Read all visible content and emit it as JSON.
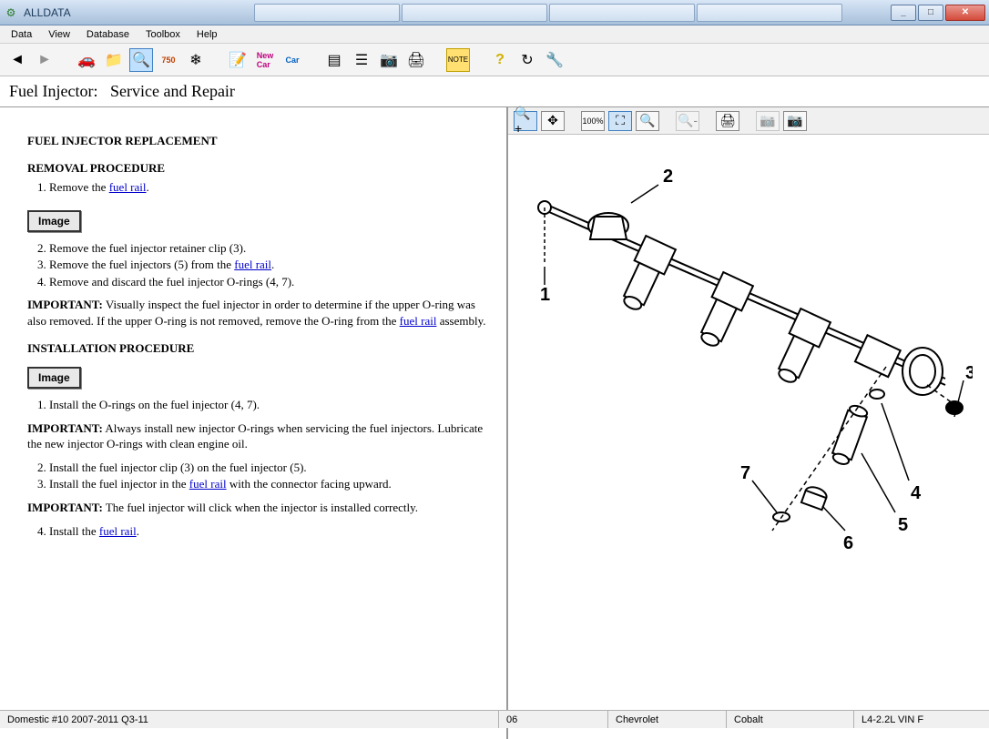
{
  "window": {
    "title": "ALLDATA"
  },
  "menu": {
    "items": [
      "Data",
      "View",
      "Database",
      "Toolbox",
      "Help"
    ]
  },
  "page": {
    "title_prefix": "Fuel Injector:",
    "title_suffix": "Service and Repair"
  },
  "content": {
    "h1": "FUEL INJECTOR REPLACEMENT",
    "h2_removal": "REMOVAL PROCEDURE",
    "removal_1_a": "Remove the ",
    "removal_1_link": "fuel rail",
    "removal_1_b": ".",
    "image_btn": "Image",
    "removal_2": "Remove the fuel injector retainer clip (3).",
    "removal_3_a": "Remove the fuel injectors (5) from the ",
    "removal_3_link": "fuel rail",
    "removal_3_b": ".",
    "removal_4": "Remove and discard the fuel injector O-rings (4, 7).",
    "important_label": "IMPORTANT:",
    "important1_a": "Visually inspect the fuel injector in order to determine if the upper O-ring was also removed. If the upper O-ring is not removed, remove the O-ring from the ",
    "important1_link": "fuel rail",
    "important1_b": " assembly.",
    "h2_install": "INSTALLATION PROCEDURE",
    "install_1": "Install the O-rings on the fuel injector (4, 7).",
    "important2": "Always install new injector O-rings when servicing the fuel injectors. Lubricate the new injector O-rings with clean engine oil.",
    "install_2": "Install the fuel injector clip (3) on the fuel injector (5).",
    "install_3_a": "Install the fuel injector in the ",
    "install_3_link": "fuel rail",
    "install_3_b": " with the connector facing upward.",
    "important3": "The fuel injector will click when the injector is installed correctly.",
    "install_4_a": "Install the ",
    "install_4_link": "fuel rail",
    "install_4_b": "."
  },
  "diagram_labels": [
    "1",
    "2",
    "3",
    "4",
    "5",
    "6",
    "7"
  ],
  "status": {
    "db": "Domestic #10 2007-2011 Q3-11",
    "year": "06",
    "make": "Chevrolet",
    "model": "Cobalt",
    "engine": "L4-2.2L VIN F"
  }
}
